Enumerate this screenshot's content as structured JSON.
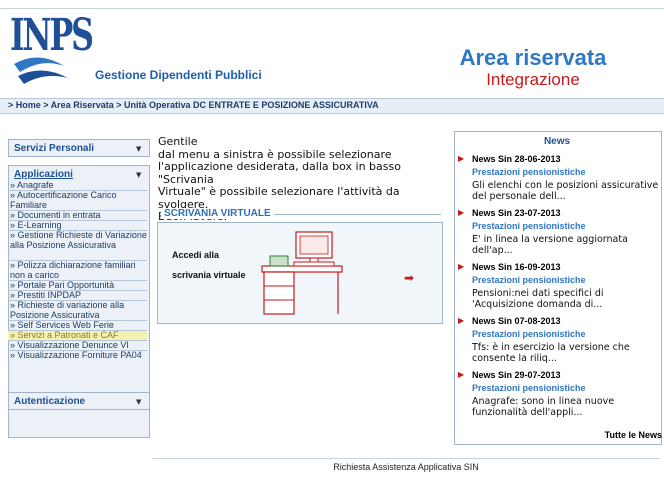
{
  "header": {
    "logo_text": "INPS",
    "subtitle": "Gestione Dipendenti Pubblici",
    "area_title": "Area riservata",
    "area_subtitle": "Integrazione"
  },
  "breadcrumb": "> Home > Area Riservata > Unità Operativa DC ENTRATE E POSIZIONE ASSICURATIVA",
  "sidebar": {
    "servizi_personali": "Servizi Personali",
    "applicazioni": "Applicazioni",
    "autenticazione": "Autenticazione",
    "items": [
      {
        "label": "Anagrafe"
      },
      {
        "label": "Autocertificazione Carico Familiare"
      },
      {
        "label": "Documenti in entrata"
      },
      {
        "label": "E-Learning"
      },
      {
        "label": "Gestione Richieste di Variazione alla Posizione Assicurativa"
      },
      {
        "label": "Polizza dichiarazione familiari non a carico"
      },
      {
        "label": "Portale Pari Opportunità"
      },
      {
        "label": "Prestiti INPDAP"
      },
      {
        "label": "Richieste di variazione alla Posizione Assicurativa"
      },
      {
        "label": "Self Services Web Ferie"
      },
      {
        "label": "Servizi a Patronati e CAF"
      },
      {
        "label": "Visualizzazione Denunce VI"
      },
      {
        "label": "Visualizzazione Forniture PA04"
      }
    ],
    "item_prefix": "»"
  },
  "main": {
    "intro_lines": [
      "Gentile",
      "dal menu a sinistra è possibile selezionare",
      "l'applicazione desiderata, dalla box in basso \"Scrivania",
      "Virtuale\" è possibile selezionare l'attività da svolgere.",
      "Buon lavoro."
    ],
    "scrivania_title": "SCRIVANIA VIRTUALE",
    "scrivania_line1": "Accedi alla",
    "scrivania_line2": "scrivania virtuale"
  },
  "news": {
    "heading": "News",
    "items": [
      {
        "title": "News Sin 28-06-2013",
        "category": "Prestazioni pensionistiche",
        "body": [
          "Gli elenchi con le posizioni assicurative",
          "del personale dell..."
        ]
      },
      {
        "title": "News Sin 23-07-2013",
        "category": "Prestazioni pensionistiche",
        "body": [
          "E' in linea la versione  aggiornata",
          "dell'ap..."
        ]
      },
      {
        "title": "News Sin 16-09-2013",
        "category": "Prestazioni pensionistiche",
        "body": [
          "Pensioni:nei dati specifici di",
          "'Acquisizione domanda di..."
        ]
      },
      {
        "title": "News Sin 07-08-2013",
        "category": "Prestazioni pensionistiche",
        "body": [
          "Tfs: è in esercizio la versione che",
          "consente la riliq..."
        ]
      },
      {
        "title": "News Sin 29-07-2013",
        "category": "Prestazioni pensionistiche",
        "body": [
          "Anagrafe: sono in linea nuove",
          "funzionalità dell'appli..."
        ]
      }
    ],
    "all_link": "Tutte le News"
  },
  "footer": "Richiesta Assistenza Applicativa SIN",
  "colors": {
    "brand_blue": "#1f4f96",
    "accent_red": "#c61b1b",
    "highlight": "#f4f2b0"
  }
}
